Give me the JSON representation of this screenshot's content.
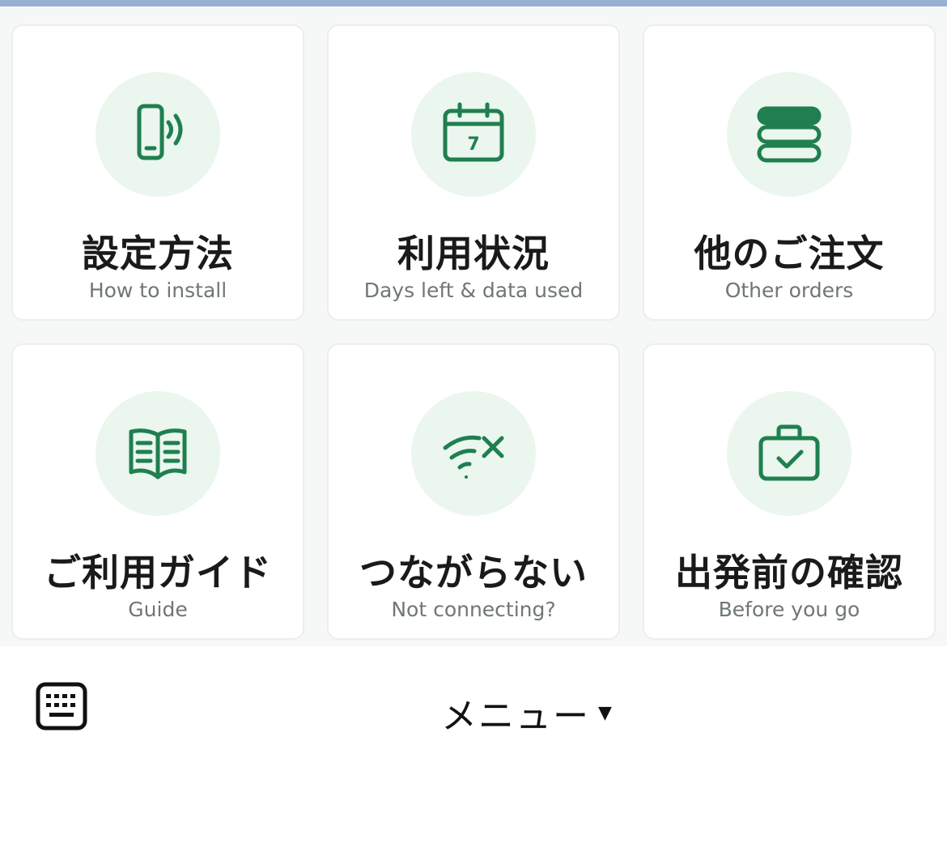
{
  "tiles": [
    {
      "title": "設定方法",
      "subtitle": "How to install",
      "icon": "phone-signal-icon"
    },
    {
      "title": "利用状況",
      "subtitle": "Days left & data used",
      "icon": "calendar-icon",
      "calendar_day": "7"
    },
    {
      "title": "他のご注文",
      "subtitle": "Other orders",
      "icon": "stack-icon"
    },
    {
      "title": "ご利用ガイド",
      "subtitle": "Guide",
      "icon": "book-icon"
    },
    {
      "title": "つながらない",
      "subtitle": "Not connecting?",
      "icon": "wifi-off-icon"
    },
    {
      "title": "出発前の確認",
      "subtitle": "Before you go",
      "icon": "suitcase-check-icon"
    }
  ],
  "bottom_bar": {
    "menu_label": "メニュー",
    "caret": "▼",
    "keyboard_icon": "keyboard-icon"
  },
  "colors": {
    "accent_green": "#1f7f4f",
    "icon_circle_bg": "#eaf6ee",
    "top_strip": "#98b0d4"
  }
}
